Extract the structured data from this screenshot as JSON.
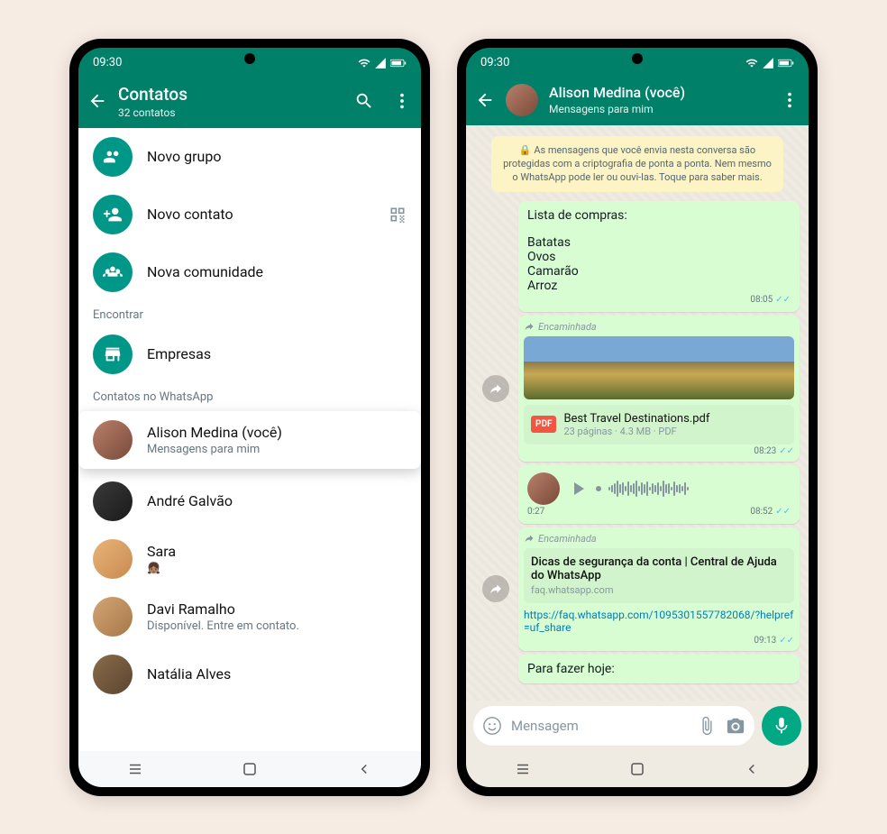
{
  "leftPhone": {
    "statusTime": "09:30",
    "header": {
      "title": "Contatos",
      "subtitle": "32 contatos"
    },
    "actions": {
      "newGroup": "Novo grupo",
      "newContact": "Novo contato",
      "newCommunity": "Nova comunidade"
    },
    "sections": {
      "find": "Encontrar",
      "businesses": "Empresas",
      "contactsOn": "Contatos no WhatsApp"
    },
    "contacts": [
      {
        "name": "Alison Medina (você)",
        "sub": "Mensagens para mim",
        "highlighted": true,
        "avatarColor": "linear-gradient(135deg,#b8806a,#7a4a3a)"
      },
      {
        "name": "André Galvão",
        "sub": "",
        "avatarColor": "linear-gradient(135deg,#3a3a3a,#1a1a1a)"
      },
      {
        "name": "Sara",
        "sub": "",
        "emoji": "👧🏽",
        "avatarColor": "linear-gradient(135deg,#e8b478,#c98a50)"
      },
      {
        "name": "Davi Ramalho",
        "sub": "Disponível. Entre em contato.",
        "avatarColor": "linear-gradient(135deg,#d4a574,#a67848)"
      },
      {
        "name": "Natália Alves",
        "sub": "",
        "avatarColor": "linear-gradient(135deg,#8b6b4a,#5a4530)"
      }
    ]
  },
  "rightPhone": {
    "statusTime": "09:30",
    "header": {
      "title": "Alison Medina (você)",
      "subtitle": "Mensagens para mim"
    },
    "encryption": "🔒 As mensagens que você envia nesta conversa são protegidas com a criptografia de ponta a ponta. Nem mesmo o WhatsApp pode ler ou ouvi-las. Toque para saber mais.",
    "messages": {
      "list": {
        "title": "Lista de compras:",
        "items": [
          "Batatas",
          "Ovos",
          "Camarão",
          "Arroz"
        ],
        "time": "08:05"
      },
      "forwardedLabel": "Encaminhada",
      "doc": {
        "name": "Best Travel Destinations.pdf",
        "meta": "23 páginas · 4.3 MB · PDF",
        "time": "08:23"
      },
      "voice": {
        "duration": "0:27",
        "time": "08:52"
      },
      "link": {
        "title": "Dicas de segurança da conta | Central de Ajuda do WhatsApp",
        "host": "faq.whatsapp.com",
        "url": "https://faq.whatsapp.com/1095301557782068/?helpref=uf_share",
        "time": "09:13"
      },
      "partial": "Para fazer hoje:"
    },
    "inputPlaceholder": "Mensagem"
  }
}
